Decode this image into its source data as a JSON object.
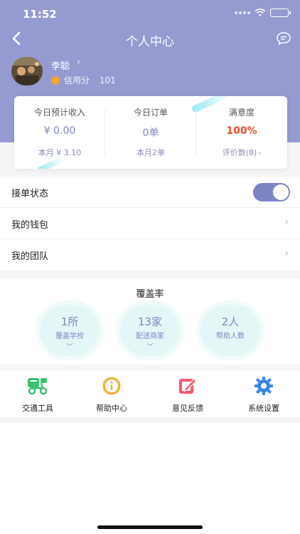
{
  "status_bar": {
    "time": "11:52"
  },
  "nav": {
    "title": "个人中心",
    "back_icon": "chevron-left-icon",
    "message_icon": "message-bubble-icon"
  },
  "profile": {
    "name": "李聪",
    "credit_label": "信用分",
    "credit_value": "101"
  },
  "stats": [
    {
      "label": "今日预计收入",
      "value": "¥ 0.00",
      "sub": "本月 ¥ 3.10"
    },
    {
      "label": "今日订单",
      "value": "0单",
      "sub": "本月2单"
    },
    {
      "label": "满意度",
      "value": "100%",
      "sub": "评价数(8)",
      "sub_arrow": "›"
    }
  ],
  "menu": {
    "order_status_label": "接单状态",
    "order_status_on": true,
    "wallet_label": "我的钱包",
    "team_label": "我的团队",
    "chevron": "›"
  },
  "coverage": {
    "title": "覆盖率",
    "items": [
      {
        "value": "1所",
        "label": "覆盖学校",
        "chevron": "﹀"
      },
      {
        "value": "13家",
        "label": "配送商家",
        "chevron": "﹀"
      },
      {
        "value": "2人",
        "label": "帮助人数"
      }
    ]
  },
  "tools": [
    {
      "label": "交通工具",
      "icon": "scooter-icon"
    },
    {
      "label": "帮助中心",
      "icon": "info-icon"
    },
    {
      "label": "意见反馈",
      "icon": "edit-feedback-icon"
    },
    {
      "label": "系统设置",
      "icon": "gear-icon"
    }
  ],
  "colors": {
    "header": "#959bd1",
    "accent": "#7f86c2",
    "satisfaction": "#ef4d2c",
    "toggle": "#7d84c4",
    "coverage_circle": "#e3f7f6"
  }
}
